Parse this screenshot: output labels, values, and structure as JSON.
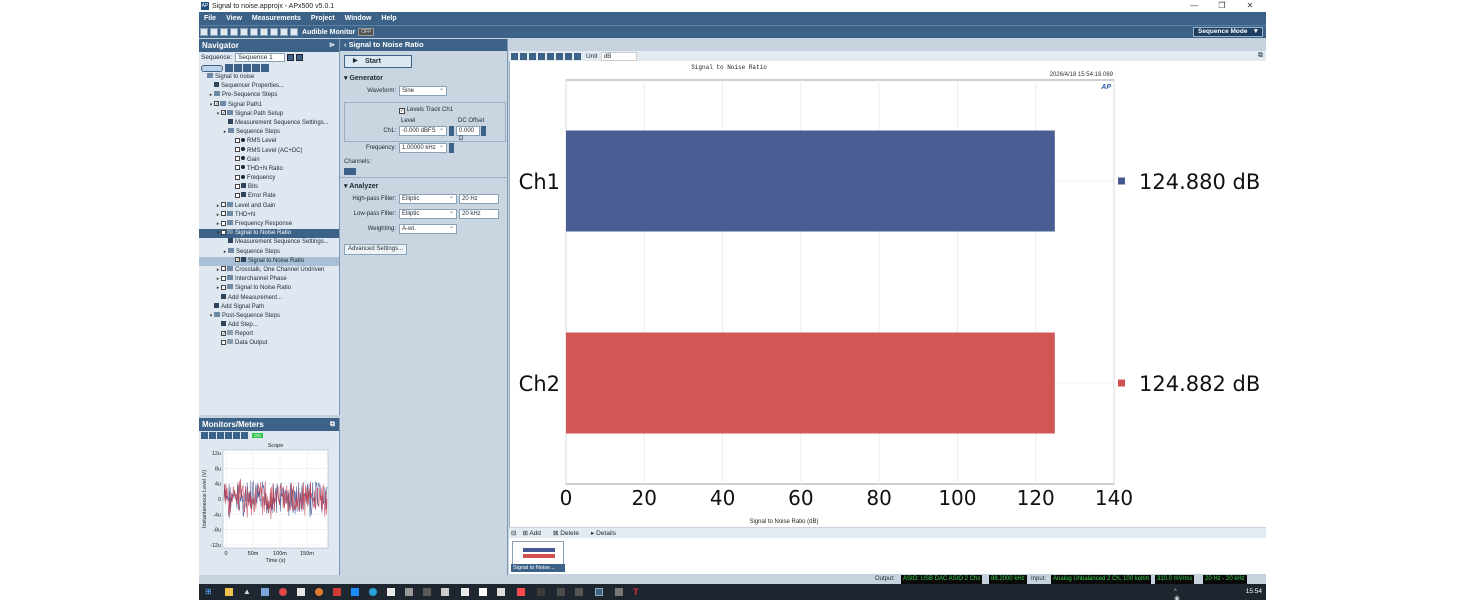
{
  "window": {
    "title": "Signal to noise.approjx - APx500 v5.0.1"
  },
  "menu": [
    "File",
    "View",
    "Measurements",
    "Project",
    "Window",
    "Help"
  ],
  "toolbar": {
    "audible_monitor": "Audible Monitor",
    "off_label": "OFF",
    "mode": "Sequence Mode"
  },
  "navigator": {
    "title": "Navigator",
    "sequence_label": "Sequence:",
    "sequence_value": "Sequence 1",
    "tree": [
      {
        "label": "Signal to noise",
        "indent": 0,
        "lead": "",
        "check": "",
        "icon": "folder"
      },
      {
        "label": "Sequencer Properties...",
        "indent": 1,
        "lead": "",
        "check": "",
        "icon": "gear"
      },
      {
        "label": "Pre-Sequence Steps",
        "indent": 1,
        "lead": "▸",
        "check": "",
        "icon": "folder"
      },
      {
        "label": "Signal Path1",
        "indent": 1,
        "lead": "▾",
        "check": "on",
        "icon": "path"
      },
      {
        "label": "Signal Path Setup",
        "indent": 2,
        "lead": "▾",
        "check": "on",
        "icon": "folder"
      },
      {
        "label": "Measurement Sequence Settings...",
        "indent": 3,
        "lead": "",
        "check": "",
        "icon": "gear"
      },
      {
        "label": "Sequence Steps",
        "indent": 3,
        "lead": "▸",
        "check": "",
        "icon": "folder"
      },
      {
        "label": "RMS Level",
        "indent": 4,
        "lead": "",
        "check": "off",
        "icon": "dot"
      },
      {
        "label": "RMS Level (AC+DC)",
        "indent": 4,
        "lead": "",
        "check": "off",
        "icon": "dot"
      },
      {
        "label": "Gain",
        "indent": 4,
        "lead": "",
        "check": "off",
        "icon": "dot"
      },
      {
        "label": "THD+N Ratio",
        "indent": 4,
        "lead": "",
        "check": "off",
        "icon": "dot"
      },
      {
        "label": "Frequency",
        "indent": 4,
        "lead": "",
        "check": "off",
        "icon": "dot"
      },
      {
        "label": "Bits",
        "indent": 4,
        "lead": "",
        "check": "off",
        "icon": "gear"
      },
      {
        "label": "Error Rate",
        "indent": 4,
        "lead": "",
        "check": "off",
        "icon": "gear"
      },
      {
        "label": "Level and Gain",
        "indent": 2,
        "lead": "▸",
        "check": "off",
        "icon": "folder"
      },
      {
        "label": "THD+N",
        "indent": 2,
        "lead": "▸",
        "check": "off",
        "icon": "folder"
      },
      {
        "label": "Frequency Response",
        "indent": 2,
        "lead": "▸",
        "check": "off",
        "icon": "folder"
      },
      {
        "label": "Signal to Noise Ratio",
        "indent": 2,
        "lead": "▾",
        "check": "on",
        "icon": "folder",
        "highlight": "hl"
      },
      {
        "label": "Measurement Sequence Settings...",
        "indent": 3,
        "lead": "",
        "check": "",
        "icon": "gear"
      },
      {
        "label": "Sequence Steps",
        "indent": 3,
        "lead": "▸",
        "check": "",
        "icon": "folder"
      },
      {
        "label": "Signal to Noise Ratio",
        "indent": 4,
        "lead": "",
        "check": "on",
        "icon": "gear",
        "highlight": "hl2"
      },
      {
        "label": "Crosstalk, One Channel Undriven",
        "indent": 2,
        "lead": "▸",
        "check": "off",
        "icon": "folder"
      },
      {
        "label": "Interchannel Phase",
        "indent": 2,
        "lead": "▸",
        "check": "off",
        "icon": "folder"
      },
      {
        "label": "Signal to Noise Ratio",
        "indent": 2,
        "lead": "▸",
        "check": "off",
        "icon": "folder"
      },
      {
        "label": "Add Measurement...",
        "indent": 2,
        "lead": "",
        "check": "",
        "icon": "add"
      },
      {
        "label": "Add Signal Path",
        "indent": 1,
        "lead": "",
        "check": "",
        "icon": "add"
      },
      {
        "label": "Post-Sequence Steps",
        "indent": 1,
        "lead": "▾",
        "check": "",
        "icon": "folder"
      },
      {
        "label": "Add Step...",
        "indent": 2,
        "lead": "",
        "check": "",
        "icon": "add"
      },
      {
        "label": "Report",
        "indent": 2,
        "lead": "",
        "check": "on",
        "icon": "doc"
      },
      {
        "label": "Data Output",
        "indent": 2,
        "lead": "",
        "check": "off",
        "icon": "doc"
      }
    ]
  },
  "monitors": {
    "title": "Monitors/Meters",
    "on_label": "ON",
    "scope": {
      "title": "Scope",
      "ylabel": "Instantaneous Level (V)",
      "xlabel": "Time (s)",
      "yticks": [
        "12u",
        "8u",
        "4u",
        "0",
        "-4u",
        "-8u",
        "-12u"
      ],
      "xticks": [
        "0",
        "50m",
        "100m",
        "150m"
      ]
    }
  },
  "panel": {
    "title": "Signal to Noise Ratio",
    "start_label": "Start",
    "generator": {
      "section": "Generator",
      "waveform_label": "Waveform:",
      "waveform_value": "Sine",
      "levels_track": "Levels Track Ch1",
      "level_header": "Level",
      "dc_header": "DC Offset",
      "ch1_label": "Ch1:",
      "level_value": "-0.000 dBFS",
      "dc_value": "0.000 D",
      "frequency_label": "Frequency:",
      "frequency_value": "1.00000 kHz",
      "channels_label": "Channels:"
    },
    "analyzer": {
      "section": "Analyzer",
      "hp_label": "High-pass Filter:",
      "hp_value": "Elliptic",
      "hp_freq": "20 Hz",
      "lp_label": "Low-pass Filter:",
      "lp_value": "Elliptic",
      "lp_freq": "20 kHz",
      "weighting_label": "Weighting:",
      "weighting_value": "A-wt.",
      "advanced_label": "Advanced Settings..."
    }
  },
  "charttools": {
    "unit_label": "Unit",
    "unit_value": "dB"
  },
  "chart_data": {
    "type": "bar",
    "orientation": "horizontal",
    "title": "Signal to Noise Ratio",
    "timestamp": "2026/4/18 15:54:18.069",
    "logo": "AP",
    "categories": [
      "Ch1",
      "Ch2"
    ],
    "values": [
      124.88,
      124.882
    ],
    "value_labels": [
      "124.880 dB",
      "124.882 dB"
    ],
    "colors": [
      "#44598f",
      "#d15151"
    ],
    "xlabel": "Signal to Noise Ratio (dB)",
    "xlim": [
      0,
      140
    ],
    "xticks": [
      0,
      20,
      40,
      60,
      80,
      100,
      120,
      140
    ],
    "grid": true
  },
  "bottombar": {
    "add": "Add",
    "delete": "Delete",
    "details": "Details",
    "thumb_label": "Signal to Noise..."
  },
  "status": {
    "output_label": "Output:",
    "output_device": "ASIO: USB DAC ASIO 2 Chs",
    "output_rate": "88.2000 kHz",
    "input_label": "Input:",
    "input_device": "Analog Unbalanced 2 Ch, 100 kohm",
    "input_level": "310.0 mVrms",
    "input_bw": "20 Hz - 20 kHz"
  },
  "taskbar": {
    "time": "15:54"
  }
}
